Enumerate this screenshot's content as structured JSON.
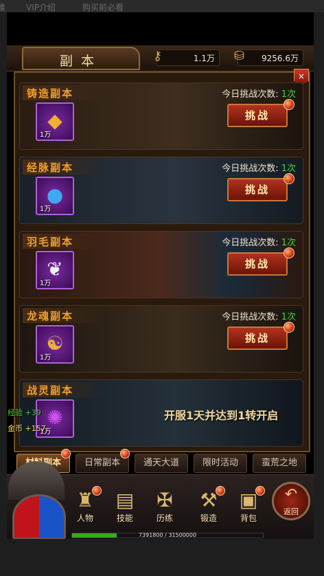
{
  "topnav": {
    "items": [
      "谁",
      "VIP介绍",
      "购买前必看"
    ]
  },
  "header": {
    "title": "副本",
    "currency_1": {
      "icon": "key-coin-icon",
      "value": "1.1万"
    },
    "currency_2": {
      "icon": "gold-ingot-icon",
      "value": "9256.6万"
    },
    "close_label": "×"
  },
  "tries_label": "今日挑战次数:",
  "dungeons": [
    {
      "name": "铸造副本",
      "icon": "gold-crystal-icon",
      "count": "1万",
      "tries": "1次",
      "button": "挑战"
    },
    {
      "name": "经脉副本",
      "icon": "blue-orb-icon",
      "count": "1万",
      "tries": "1次",
      "button": "挑战"
    },
    {
      "name": "羽毛副本",
      "icon": "white-feather-icon",
      "count": "1万",
      "tries": "1次",
      "button": "挑战"
    },
    {
      "name": "龙魂副本",
      "icon": "gold-dragon-soul-icon",
      "count": "1万",
      "tries": "1次",
      "button": "挑战"
    },
    {
      "name": "战灵副本",
      "icon": "purple-spirit-icon",
      "count": "1万",
      "locked_text": "开服1天并达到1转开启"
    }
  ],
  "float_text": {
    "exp": "经验 +39",
    "gold": "金币 +157"
  },
  "tabs": [
    {
      "label": "材料副本",
      "active": true,
      "badge": true
    },
    {
      "label": "日常副本",
      "active": false,
      "badge": true
    },
    {
      "label": "通天大道",
      "active": false,
      "badge": false
    },
    {
      "label": "限时活动",
      "active": false,
      "badge": false
    },
    {
      "label": "蛮荒之地",
      "active": false,
      "badge": false
    }
  ],
  "dock": {
    "nav": [
      {
        "label": "人物",
        "icon": "character-icon",
        "badge": true
      },
      {
        "label": "技能",
        "icon": "skill-book-icon",
        "badge": false
      },
      {
        "label": "历练",
        "icon": "training-icon",
        "badge": false
      },
      {
        "label": "锻造",
        "icon": "anvil-icon",
        "badge": true
      },
      {
        "label": "背包",
        "icon": "backpack-icon",
        "badge": true
      }
    ],
    "back_label": "返回",
    "exp": {
      "current": 7391800,
      "max": 31500000,
      "text": "7391800 / 31500000"
    }
  },
  "colors": {
    "accent": "#f0a030",
    "tries_num": "#4ad040",
    "button": "#b2321e"
  }
}
